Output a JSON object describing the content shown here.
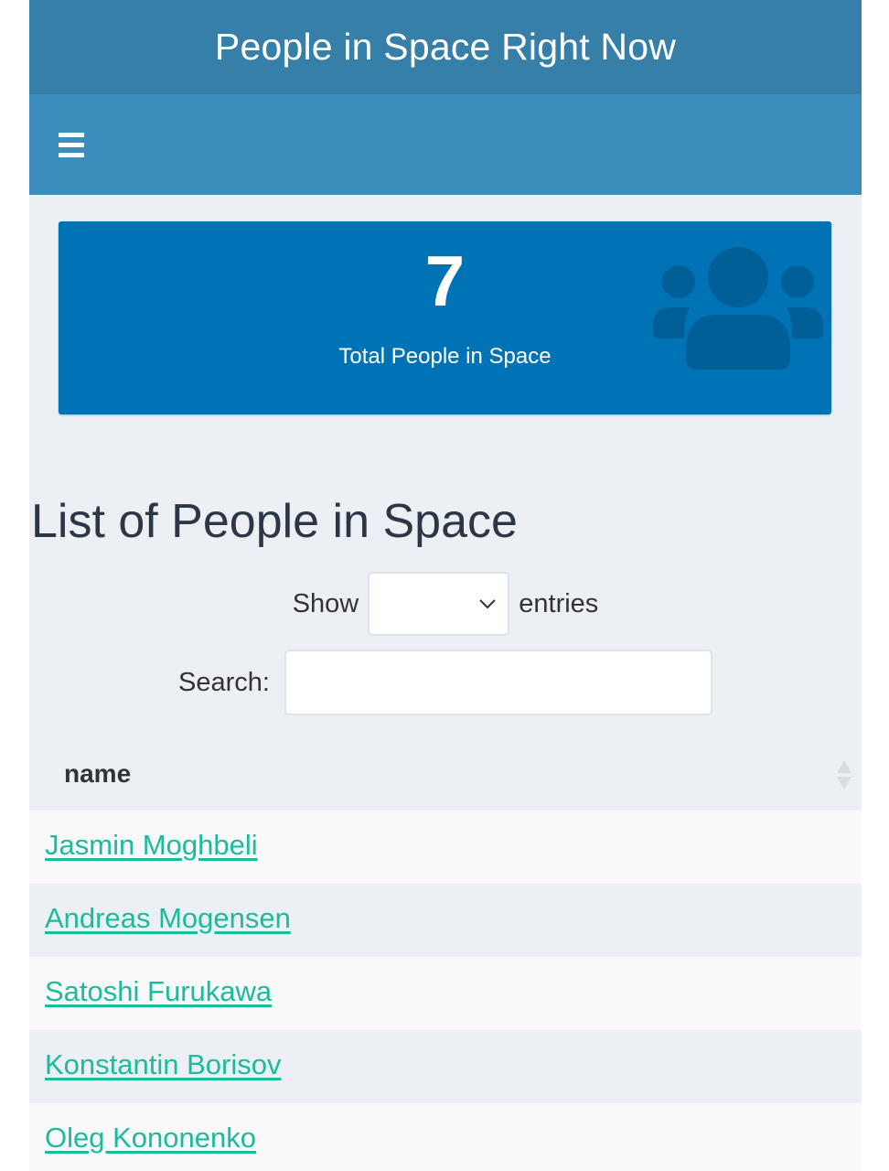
{
  "header": {
    "title": "People in Space Right Now"
  },
  "navbar": {
    "menu_icon": "hamburger-menu-icon"
  },
  "value_box": {
    "value": "7",
    "label": "Total People in Space",
    "icon": "users-icon",
    "color": "#0073b7"
  },
  "list": {
    "title": "List of People in Space",
    "show_label": "Show",
    "show_select_value": "",
    "entries_label": "entries",
    "search_label": "Search:",
    "search_value": "",
    "columns": [
      "name"
    ],
    "rows": [
      {
        "name": "Jasmin Moghbeli"
      },
      {
        "name": "Andreas Mogensen"
      },
      {
        "name": "Satoshi Furukawa"
      },
      {
        "name": "Konstantin Borisov"
      },
      {
        "name": "Oleg Kononenko"
      }
    ],
    "link_color": "#1abc9c"
  },
  "colors": {
    "title_bar": "#367fa9",
    "nav_bar": "#3c8dbc",
    "content_bg": "#ecf0f5"
  }
}
